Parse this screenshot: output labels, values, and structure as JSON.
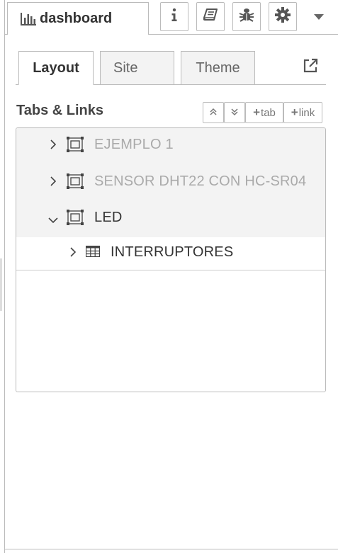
{
  "sidebar_tab": {
    "label": "dashboard",
    "icon": "bar-chart-icon"
  },
  "toolbar": {
    "buttons": [
      {
        "name": "info",
        "icon": "info-icon"
      },
      {
        "name": "help",
        "icon": "book-icon"
      },
      {
        "name": "debug",
        "icon": "bug-icon"
      },
      {
        "name": "settings",
        "icon": "gear-icon"
      }
    ],
    "dropdown_icon": "caret-down-icon"
  },
  "tabs": [
    {
      "label": "Layout",
      "active": true
    },
    {
      "label": "Site",
      "active": false
    },
    {
      "label": "Theme",
      "active": false
    }
  ],
  "external_link_icon": "external-link-icon",
  "section": {
    "title": "Tabs & Links",
    "buttons": {
      "collapse_all": "collapse-all-icon",
      "expand_all": "expand-all-icon",
      "add_tab": "tab",
      "add_link": "link"
    }
  },
  "tree": {
    "items": [
      {
        "label": "EJEMPLO 1",
        "type": "tab",
        "expanded": false,
        "disabled": true,
        "icon": "tab-icon"
      },
      {
        "label": "SENSOR DHT22 CON HC-SR04",
        "type": "tab",
        "expanded": false,
        "disabled": true,
        "icon": "tab-icon"
      },
      {
        "label": "LED",
        "type": "tab",
        "expanded": true,
        "disabled": false,
        "icon": "tab-icon"
      },
      {
        "label": "INTERRUPTORES",
        "type": "group",
        "expanded": false,
        "disabled": false,
        "icon": "table-icon"
      }
    ]
  },
  "colors": {
    "row_bg": "#f3f3f3",
    "border": "#bbbbbb",
    "disabled_text": "#aaaaaa"
  }
}
